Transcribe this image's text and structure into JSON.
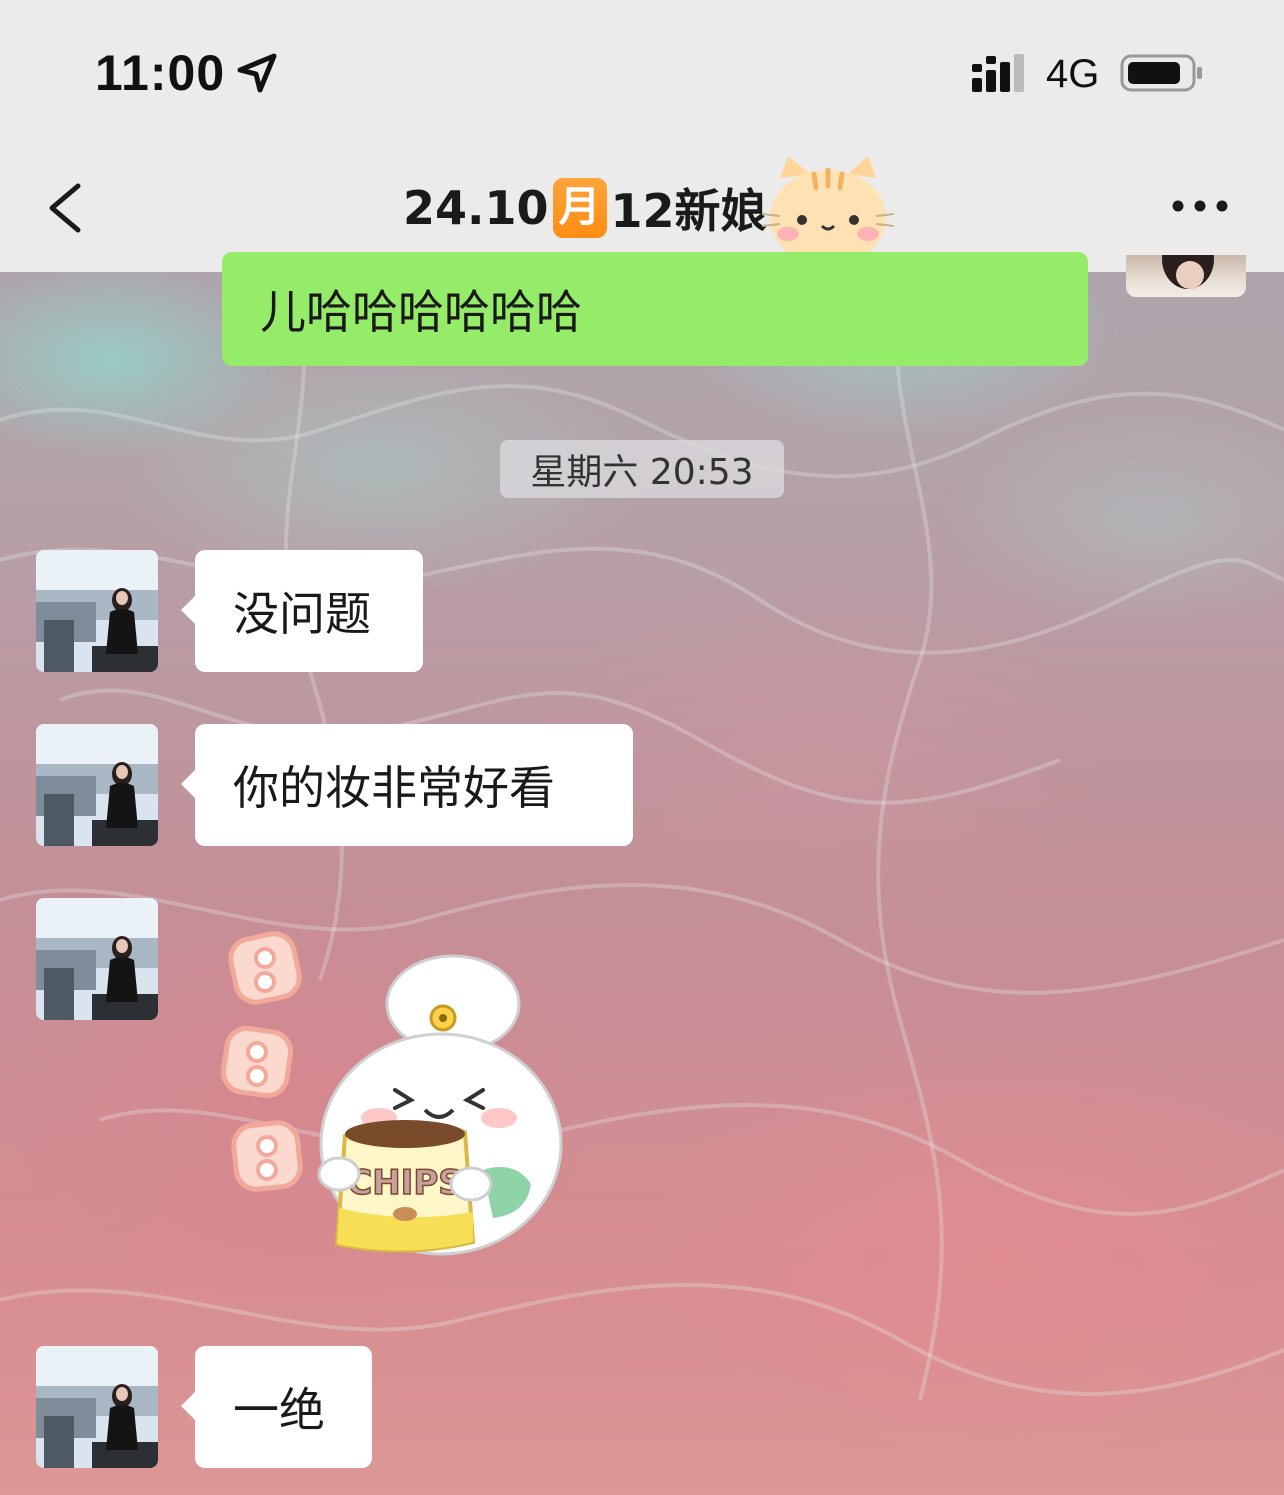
{
  "status_bar": {
    "time": "11:00",
    "network": "4G"
  },
  "nav": {
    "title_prefix": "24.10",
    "title_badge": "月",
    "title_suffix": "12新娘"
  },
  "messages": {
    "outgoing_partial": "儿哈哈哈哈哈哈",
    "timestamp": "星期六 20:53",
    "incoming": [
      {
        "text": "没问题"
      },
      {
        "text": "你的妆非常好看"
      },
      {
        "sticker": "chips-sticker"
      },
      {
        "text": "一绝"
      }
    ]
  },
  "sticker": {
    "bag_text": "CHIPS"
  },
  "icons": {
    "back": "back-chevron-icon",
    "more": "more-dots-icon",
    "location": "location-arrow-icon",
    "signal": "signal-icon",
    "battery": "battery-icon",
    "cat": "cat-emoji-icon"
  },
  "colors": {
    "outgoing_bubble": "#95ec69",
    "incoming_bubble": "#ffffff",
    "header_bg": "#ebebeb",
    "badge": "#ff9a25"
  }
}
